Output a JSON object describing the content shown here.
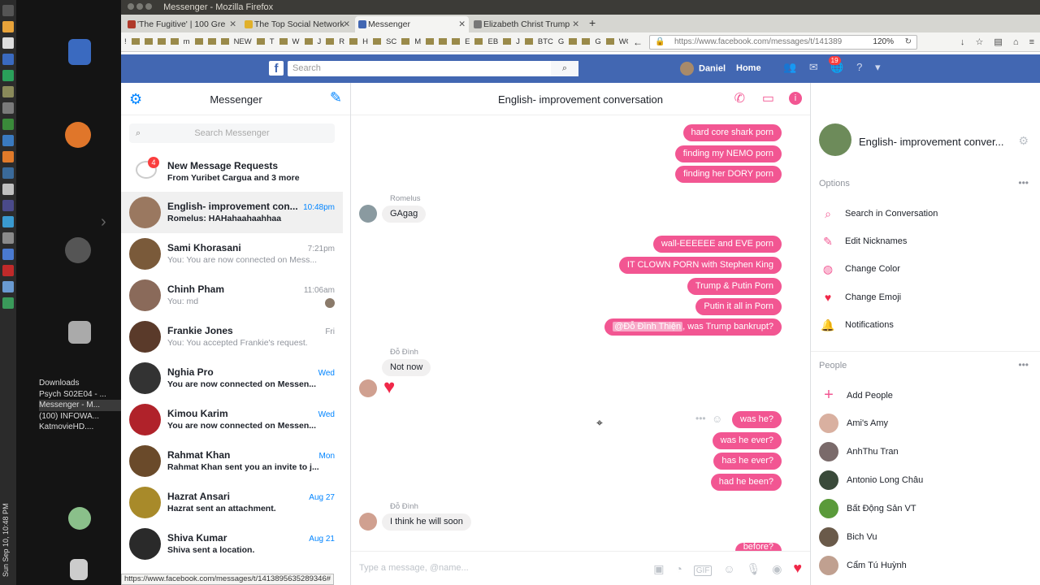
{
  "window": {
    "title": "Messenger - Mozilla Firefox"
  },
  "tabs": [
    {
      "label": "'The Fugitive' | 100 Gre",
      "active": false
    },
    {
      "label": "The Top Social Network",
      "active": false
    },
    {
      "label": "Messenger",
      "active": true
    },
    {
      "label": "Elizabeth Christ Trump",
      "active": false
    }
  ],
  "bookmarks": [
    "!",
    "",
    "",
    "",
    "",
    "m",
    "",
    "",
    "",
    "NEW",
    "",
    "T",
    "",
    "W",
    "",
    "J",
    "",
    "R",
    "",
    "H",
    "",
    "SC",
    "",
    "M",
    "",
    "",
    "",
    "E",
    "",
    "EB",
    "",
    "J",
    "",
    "BTC",
    "G",
    "",
    "",
    "G",
    "",
    "WOW"
  ],
  "address": {
    "url": "https://www.facebook.com/messages/t/141389",
    "zoom": "120%"
  },
  "fb": {
    "search_placeholder": "Search",
    "user": "Daniel",
    "home": "Home",
    "notif_count": "19"
  },
  "desktop": {
    "tasks": [
      "Downloads",
      "Psych S02E04 - ...",
      "Messenger - M...",
      "(100) INFOWA...",
      "KatmovieHD...."
    ],
    "clock": "Sun Sep 10, 10:48 PM",
    "lang": "en"
  },
  "left": {
    "title": "Messenger",
    "search_placeholder": "Search Messenger",
    "requests": {
      "count": "4",
      "title": "New Message Requests",
      "subtitle": "From Yuribet Cargua and 3 more"
    },
    "conversations": [
      {
        "name": "English- improvement con...",
        "time": "10:48pm",
        "snippet": "Romelus: HAHahaahaahhaa",
        "bold": true,
        "blue": true,
        "active": true,
        "color": "#9a7860"
      },
      {
        "name": "Sami Khorasani",
        "time": "7:21pm",
        "snippet": "You: You are now connected on Mess...",
        "bold": false,
        "blue": false,
        "active": false,
        "color": "#7a5a3a"
      },
      {
        "name": "Chinh Pham",
        "time": "11:06am",
        "snippet": "You: md",
        "bold": false,
        "blue": false,
        "active": false,
        "color": "#8a6a5a"
      },
      {
        "name": "Frankie Jones",
        "time": "Fri",
        "snippet": "You: You accepted Frankie's request.",
        "bold": false,
        "blue": false,
        "active": false,
        "color": "#5a3a2a"
      },
      {
        "name": "Nghia Pro",
        "time": "Wed",
        "snippet": "You are now connected on Messen...",
        "bold": true,
        "blue": true,
        "active": false,
        "color": "#333333"
      },
      {
        "name": "Kimou Karim",
        "time": "Wed",
        "snippet": "You are now connected on Messen...",
        "bold": true,
        "blue": true,
        "active": false,
        "color": "#b0222a"
      },
      {
        "name": "Rahmat Khan",
        "time": "Mon",
        "snippet": "Rahmat Khan sent you an invite to j...",
        "bold": true,
        "blue": true,
        "active": false,
        "color": "#6a4a2a"
      },
      {
        "name": "Hazrat Ansari",
        "time": "Aug 27",
        "snippet": "Hazrat sent an attachment.",
        "bold": true,
        "blue": true,
        "active": false,
        "color": "#a88a2a"
      },
      {
        "name": "Shiva Kumar",
        "time": "Aug 21",
        "snippet": "Shiva sent a location.",
        "bold": true,
        "blue": true,
        "active": false,
        "color": "#2a2a2a"
      }
    ]
  },
  "center": {
    "title": "English- improvement conversation",
    "composer_placeholder": "Type a message, @name...",
    "messages": {
      "m1": "hard core shark porn",
      "m2": "finding my NEMO porn",
      "m3": "finding her DORY porn",
      "s1": "Romelus",
      "m4": "GAgag",
      "m5": "wall-EEEEEE and EVE porn",
      "m6": "IT CLOWN PORN with Stephen King",
      "m7": "Trump & Putin Porn",
      "m8": "Putin it all in Porn",
      "m9_mention": "@Đỗ Đình Thiện",
      "m9_rest": ", was Trump bankrupt?",
      "s2": "Đỗ Đình",
      "m10": "Not now",
      "m11": "was he?",
      "m12": "was he ever?",
      "m13": "has he ever?",
      "m14": "had he been?",
      "s3": "Đỗ Đình",
      "m15": "I think he will soon",
      "m16": "before?"
    }
  },
  "right": {
    "title": "English- improvement conver...",
    "options_header": "Options",
    "options": [
      "Search in Conversation",
      "Edit Nicknames",
      "Change Color",
      "Change Emoji",
      "Notifications"
    ],
    "people_header": "People",
    "add_people": "Add People",
    "people": [
      {
        "name": "Ami's Amy",
        "color": "#d9b0a0"
      },
      {
        "name": "AnhThu Tran",
        "color": "#7a6a6a"
      },
      {
        "name": "Antonio Long Châu",
        "color": "#3a4a3a"
      },
      {
        "name": "Bất Động Sản VT",
        "color": "#5a9a3a"
      },
      {
        "name": "Bich Vu",
        "color": "#6a5a4a"
      },
      {
        "name": "Cẩm Tú Huỳnh",
        "color": "#c0a090"
      }
    ]
  },
  "status": {
    "url": "https://www.facebook.com/messages/t/1413895635289346#"
  },
  "colors": {
    "accent": "#f25692",
    "fb_blue": "#4267b2",
    "messenger_blue": "#0084ff"
  }
}
